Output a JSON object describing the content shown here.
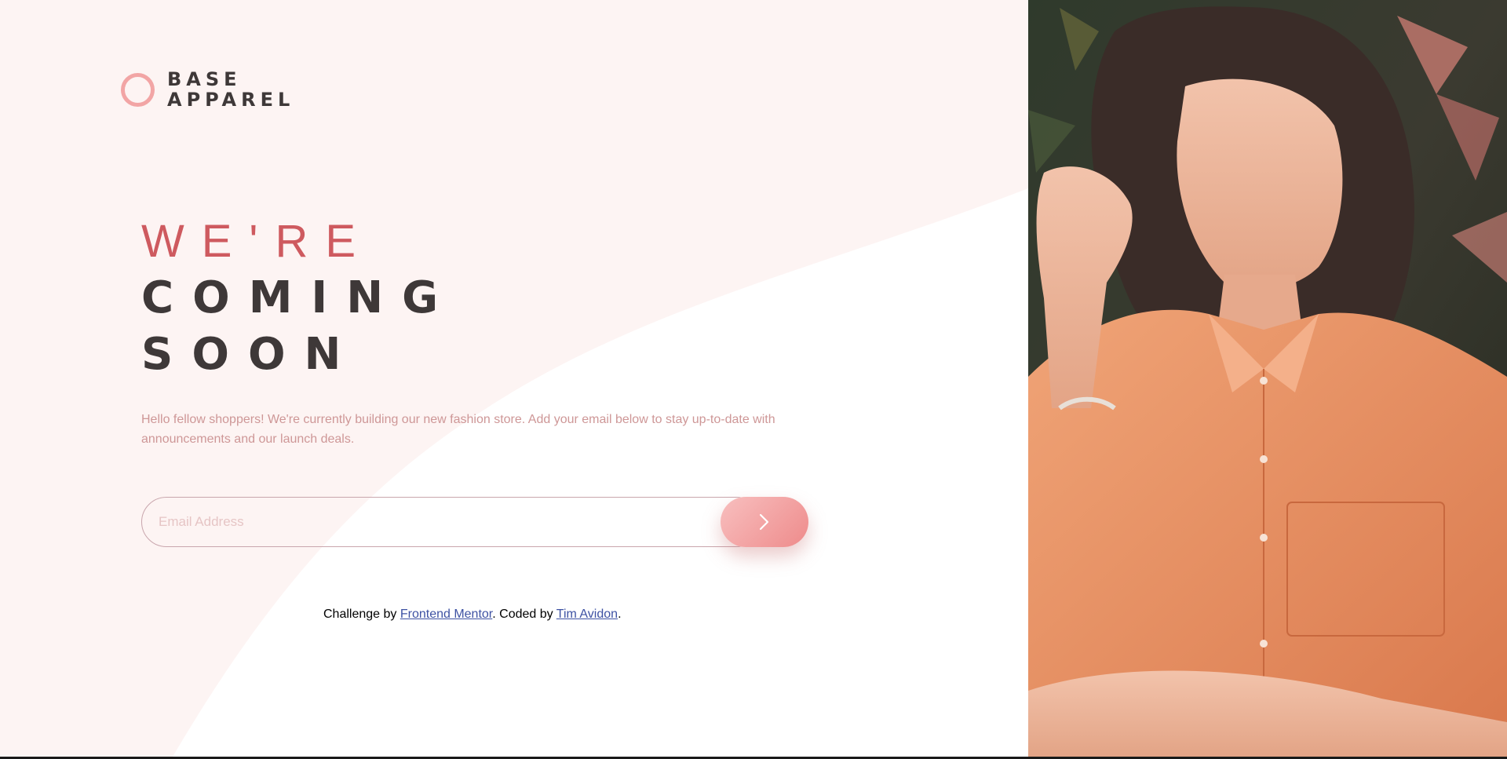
{
  "logo": {
    "line1": "BASE",
    "line2": "APPAREL"
  },
  "headline": {
    "line1": "WE'RE",
    "line2": "COMING",
    "line3": "SOON"
  },
  "intro": "Hello fellow shoppers! We're currently building our new fashion store. Add your email below to stay up-to-date with announcements and our launch deals.",
  "form": {
    "email_placeholder": "Email Address",
    "email_value": "",
    "submit_icon": "chevron-right-icon"
  },
  "attribution": {
    "prefix": "Challenge by ",
    "link1": "Frontend Mentor",
    "middle": ". Coded by ",
    "link2": "Tim Avidon",
    "suffix": "."
  },
  "colors": {
    "accent": "#ce5a5f",
    "dark": "#3e3838",
    "desaturated_red": "#ce9797",
    "gradient_start": "#f8bfbf",
    "gradient_end": "#ee8b8b",
    "shirt": "#e98a5c",
    "link": "#3e52a3"
  }
}
